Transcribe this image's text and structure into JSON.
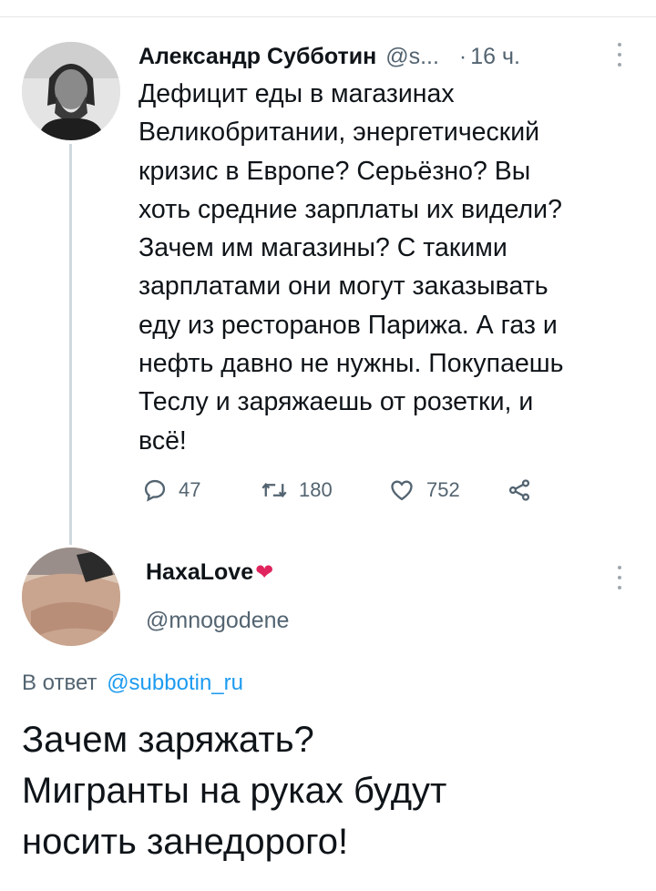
{
  "tweet1": {
    "name": "Александр Субботин",
    "handle": "@s...",
    "separator": "·",
    "time": "16 ч.",
    "text_lines": [
      "Дефицит еды в магазинах",
      "Великобритании, энергетический",
      "кризис в Европе? Серьёзно? Вы",
      "хоть средние зарплаты их видели?",
      "Зачем им магазины? С такими",
      "зарплатами они могут заказывать",
      "еду из ресторанов Парижа. А газ и",
      "нефть давно не нужны. Покупаешь",
      "Теслу и заряжаешь от розетки, и",
      "всё!"
    ],
    "actions": {
      "reply_icon": "reply-icon",
      "reply_count": "47",
      "retweet_icon": "retweet-icon",
      "retweet_count": "180",
      "like_icon": "heart-icon",
      "like_count": "752",
      "share_icon": "share-icon"
    }
  },
  "tweet2": {
    "name": "НахаLove",
    "name_emoji": "❤",
    "handle": "@mnogodene",
    "reply_prefix": "В ответ",
    "reply_mention": "@subbotin_ru",
    "text_lines": [
      "Зачем заряжать?",
      "Мигранты на руках будут",
      "носить занедорого!"
    ]
  },
  "colors": {
    "text": "#0f1419",
    "secondary": "#536471",
    "link": "#1d9bf0",
    "heart": "#e0245e",
    "thread_line": "#cfd9de"
  }
}
